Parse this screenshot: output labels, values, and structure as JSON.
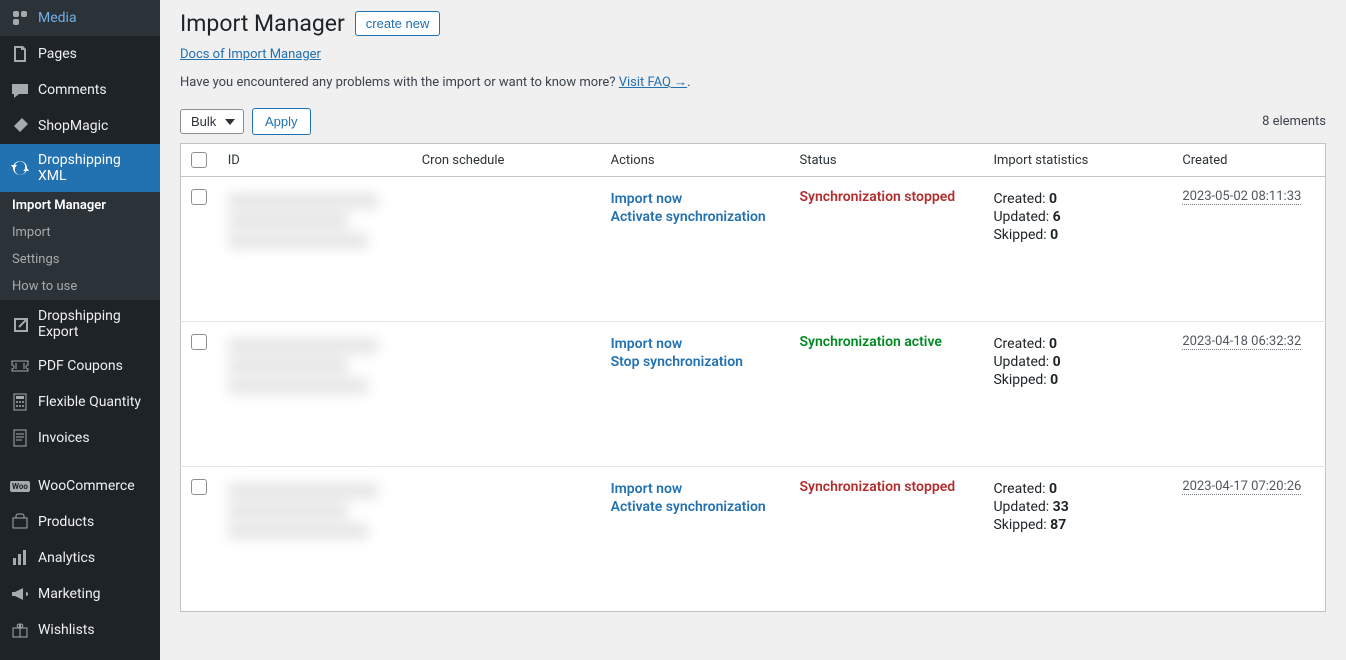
{
  "sidebar": {
    "items": [
      {
        "label": "Media"
      },
      {
        "label": "Pages"
      },
      {
        "label": "Comments"
      },
      {
        "label": "ShopMagic"
      },
      {
        "label": "Dropshipping XML"
      },
      {
        "label": "Dropshipping Export"
      },
      {
        "label": "PDF Coupons"
      },
      {
        "label": "Flexible Quantity"
      },
      {
        "label": "Invoices"
      },
      {
        "label": "WooCommerce"
      },
      {
        "label": "Products"
      },
      {
        "label": "Analytics"
      },
      {
        "label": "Marketing"
      },
      {
        "label": "Wishlists"
      }
    ],
    "submenu": [
      {
        "label": "Import Manager",
        "current": true
      },
      {
        "label": "Import"
      },
      {
        "label": "Settings"
      },
      {
        "label": "How to use"
      }
    ]
  },
  "header": {
    "title": "Import Manager",
    "create_label": "create new",
    "docs_link": "Docs of Import Manager",
    "faq_prefix": "Have you encountered any problems with the import or want to know more? ",
    "faq_link": "Visit FAQ →",
    "faq_suffix": ".",
    "bulk_label": "Bulk",
    "apply_label": "Apply",
    "elements_count": "8 elements"
  },
  "table": {
    "columns": {
      "id": "ID",
      "cron": "Cron schedule",
      "actions": "Actions",
      "status": "Status",
      "stats": "Import statistics",
      "created": "Created"
    },
    "rows": [
      {
        "actions": [
          "Import now",
          "Activate synchronization"
        ],
        "status": "Synchronization stopped",
        "status_class": "status-stopped",
        "stats": [
          {
            "label": "Created:",
            "value": "0"
          },
          {
            "label": "Updated:",
            "value": "6"
          },
          {
            "label": "Skipped:",
            "value": "0"
          }
        ],
        "created": "2023-05-02 08:11:33"
      },
      {
        "actions": [
          "Import now",
          "Stop synchronization"
        ],
        "status": "Synchronization active",
        "status_class": "status-active",
        "stats": [
          {
            "label": "Created:",
            "value": "0"
          },
          {
            "label": "Updated:",
            "value": "0"
          },
          {
            "label": "Skipped:",
            "value": "0"
          }
        ],
        "created": "2023-04-18 06:32:32"
      },
      {
        "actions": [
          "Import now",
          "Activate synchronization"
        ],
        "status": "Synchronization stopped",
        "status_class": "status-stopped",
        "stats": [
          {
            "label": "Created:",
            "value": "0"
          },
          {
            "label": "Updated:",
            "value": "33"
          },
          {
            "label": "Skipped:",
            "value": "87"
          }
        ],
        "created": "2023-04-17 07:20:26"
      }
    ]
  }
}
